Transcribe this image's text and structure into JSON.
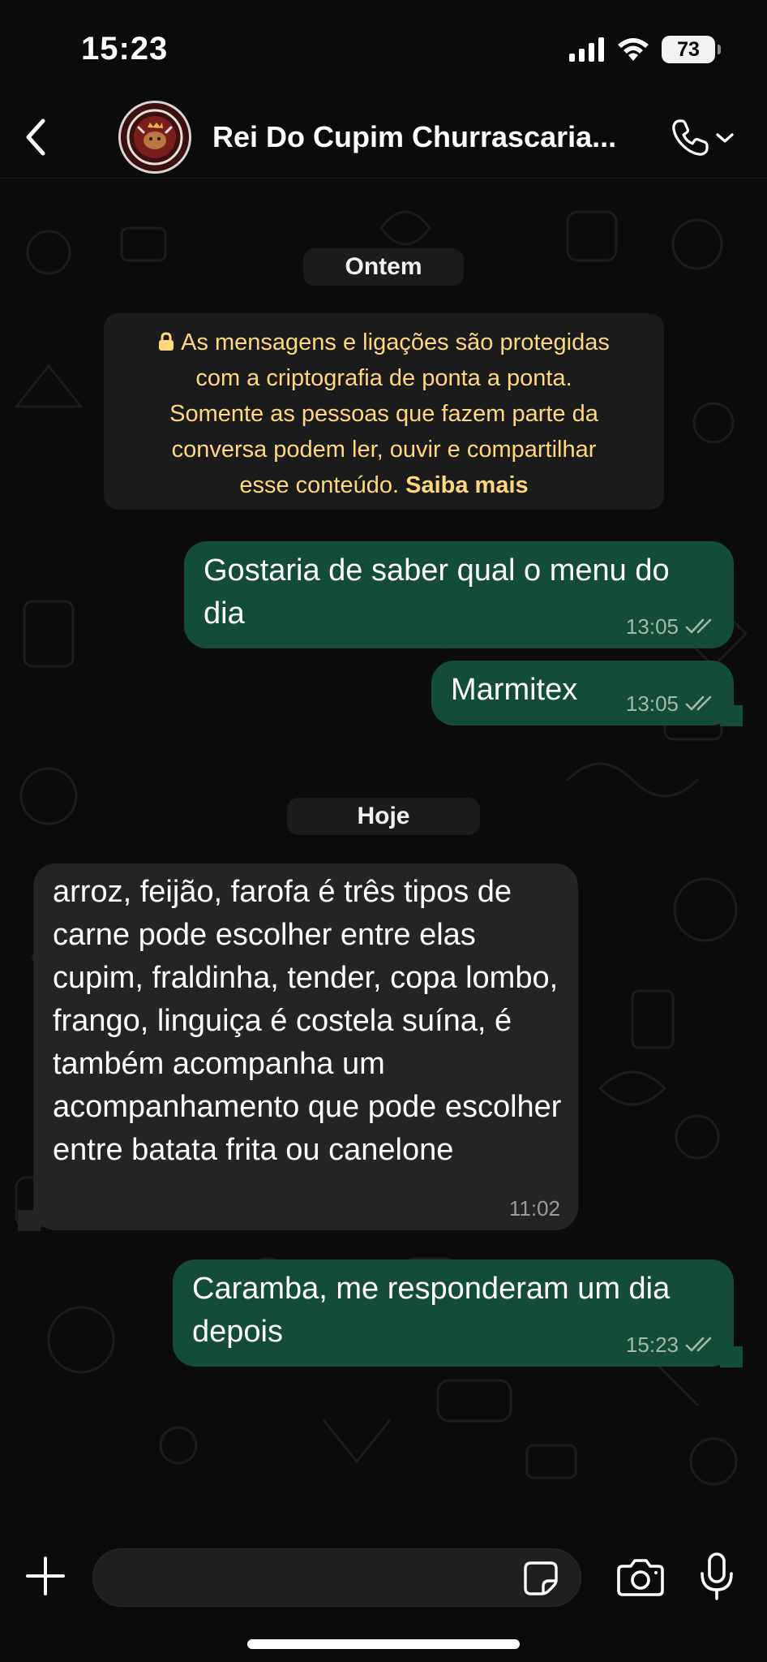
{
  "status_bar": {
    "time": "15:23",
    "battery": "73",
    "icons": [
      "cellular-signal-icon",
      "wifi-icon",
      "battery-icon"
    ]
  },
  "header": {
    "contact_name": "Rei Do Cupim Churrascaria...",
    "avatar_logo_text": "REI DO CUPIM CHURRASCARIA",
    "icons": [
      "back-chevron-icon",
      "phone-icon",
      "chevron-down-icon"
    ]
  },
  "chat": {
    "date_yesterday": "Ontem",
    "date_today": "Hoje",
    "encryption_notice": {
      "text": "As mensagens e ligações são protegidas com a criptografia de ponta a ponta. Somente as pessoas que fazem parte da conversa podem ler, ouvir e compartilhar esse conteúdo.",
      "line1": "As mensagens e ligações são protegidas",
      "line2": "com a criptografia de ponta a ponta.",
      "line3": "Somente as pessoas que fazem parte da",
      "line4": "conversa podem ler, ouvir e compartilhar",
      "line5": "esse conteúdo.",
      "link": "Saiba mais"
    },
    "messages": [
      {
        "direction": "outgoing",
        "text": "Gostaria de saber qual o menu do dia",
        "time": "13:05",
        "status": "read"
      },
      {
        "direction": "outgoing",
        "text": "Marmitex",
        "time": "13:05",
        "status": "read"
      },
      {
        "direction": "incoming",
        "text": "arroz, feijão, farofa é três tipos de carne pode escolher entre elas cupim, fraldinha, tender, copa lombo, frango, linguiça é costela suína, é também acompanha um acompanhamento que pode escolher entre batata frita ou canelone",
        "time": "11:02"
      },
      {
        "direction": "outgoing",
        "text": "Caramba, me responderam um dia depois",
        "time": "15:23",
        "status": "read"
      }
    ]
  },
  "composer": {
    "placeholder": "",
    "icons": [
      "plus-icon",
      "sticker-icon",
      "camera-icon",
      "microphone-icon"
    ]
  },
  "colors": {
    "background": "#0b0b0b",
    "outgoing_bubble": "#144d37",
    "incoming_bubble": "#242424",
    "system_text": "#ffd77d",
    "read_ticks": "#a3b8ad"
  }
}
